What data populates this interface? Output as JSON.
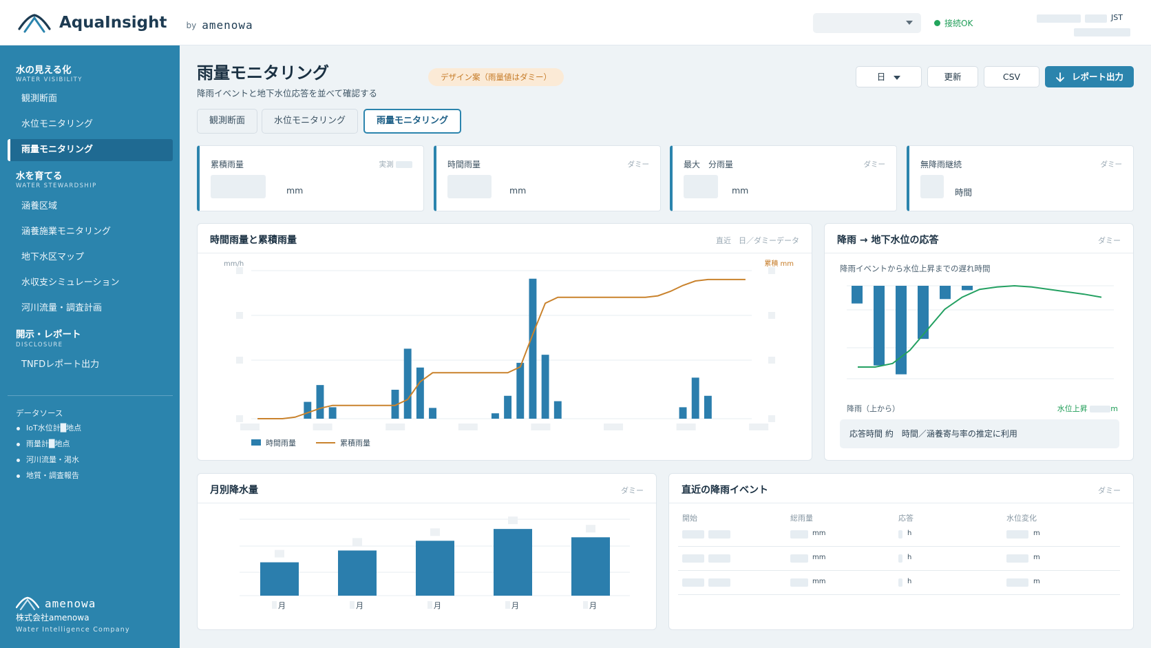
{
  "header": {
    "app_name": "AquaInsight",
    "by": "by",
    "vendor": "amenowa",
    "status": "接続OK",
    "timezone": "JST"
  },
  "sidebar": {
    "sections": [
      {
        "title": "水の見える化",
        "sub": "WATER VISIBILITY"
      },
      {
        "title": "水を育てる",
        "sub": "WATER STEWARDSHIP"
      },
      {
        "title": "開示・レポート",
        "sub": "DISCLOSURE"
      }
    ],
    "items": [
      {
        "label": "観測断面"
      },
      {
        "label": "水位モニタリング"
      },
      {
        "label": "雨量モニタリング"
      },
      {
        "label": "涵養区域"
      },
      {
        "label": "涵養施業モニタリング"
      },
      {
        "label": "地下水区マップ"
      },
      {
        "label": "水収支シミュレーション"
      },
      {
        "label": "河川流量・調査計画"
      },
      {
        "label": "TNFDレポート出力"
      }
    ],
    "datasource_title": "データソース",
    "datasources": [
      "IoT水位計█地点",
      "雨量計█地点",
      "河川流量・渇水",
      "地質・調査報告"
    ],
    "footer": {
      "brand": "amenowa",
      "company": "株式会社amenowa",
      "tagline": "Water Intelligence Company"
    }
  },
  "page": {
    "title": "雨量モニタリング",
    "subtitle": "降雨イベントと地下水位応答を並べて確認する",
    "design_badge": "デザイン案（雨量値はダミー）"
  },
  "toolbar": {
    "period": "日",
    "refresh": "更新",
    "csv": "CSV",
    "report": "レポート出力"
  },
  "tabs": [
    "観測断面",
    "水位モニタリング",
    "雨量モニタリング"
  ],
  "kpis": [
    {
      "label": "累積雨量",
      "tag": "実測",
      "unit": "mm"
    },
    {
      "label": "時間雨量",
      "tag": "ダミー",
      "unit": "mm"
    },
    {
      "label": "最大　分雨量",
      "tag": "ダミー",
      "unit": "mm"
    },
    {
      "label": "無降雨継続",
      "tag": "ダミー",
      "unit": "時間"
    }
  ],
  "panels": {
    "hourly": {
      "title": "時間雨量と累積雨量",
      "tag": "直近　日／ダミーデータ"
    },
    "response": {
      "title": "降雨 → 地下水位の応答",
      "tag": "ダミー",
      "subtitle": "降雨イベントから水位上昇までの遅れ時間",
      "left_label": "降雨（上から）",
      "right_label": "水位上昇",
      "right_unit": "m",
      "note": "応答時間 約　時間／涵養寄与率の推定に利用"
    },
    "monthly": {
      "title": "月別降水量",
      "tag": "ダミー",
      "month_unit": "月"
    },
    "events": {
      "title": "直近の降雨イベント",
      "tag": "ダミー",
      "headers": [
        "開始",
        "総雨量",
        "応答",
        "水位変化"
      ],
      "units": [
        "mm",
        "h",
        "m"
      ],
      "row_count": 3
    }
  },
  "chart_data": [
    {
      "type": "bar",
      "title": "時間雨量と累積雨量",
      "y_left_label": "mm/h",
      "y_right_label": "累積 mm",
      "series": [
        {
          "name": "時間雨量",
          "type": "bar",
          "values": [
            0,
            0,
            0,
            0,
            2.5,
            5,
            1.7,
            0,
            0,
            0,
            0,
            4.3,
            10.4,
            7.6,
            1.6,
            0,
            0,
            0,
            0,
            0.8,
            3.4,
            8.3,
            20.8,
            9.5,
            2.6,
            0,
            0,
            0,
            0,
            0,
            0,
            0,
            0,
            0,
            1.7,
            6.1,
            3.4,
            0,
            0,
            0
          ]
        },
        {
          "name": "累積雨量",
          "type": "line",
          "values": [
            0,
            0,
            0,
            1,
            4,
            7,
            9,
            9,
            9,
            9,
            9,
            9,
            13,
            25,
            31,
            31,
            31,
            31,
            31,
            31,
            31,
            35,
            57,
            78,
            82,
            82,
            82,
            82,
            82,
            82,
            82,
            82,
            83,
            86,
            90,
            93,
            94,
            94,
            94,
            94
          ]
        }
      ],
      "legend": "bottom-left",
      "grid": true
    },
    {
      "type": "bar",
      "title": "降雨 → 地下水位の応答",
      "series": [
        {
          "name": "降雨（上から）",
          "type": "bar",
          "values": [
            2,
            9,
            10,
            6,
            1.5,
            0.5
          ]
        },
        {
          "name": "水位上昇",
          "type": "line",
          "values": [
            0,
            0,
            0.6,
            2.8,
            6.2,
            9.6,
            11.6,
            12.9,
            13.3,
            13.5,
            13.3,
            12.9,
            12.5,
            12.1,
            11.6
          ]
        }
      ],
      "grid": true
    },
    {
      "type": "bar",
      "title": "月別降水量",
      "values": [
        48,
        65,
        79,
        96,
        84
      ],
      "ylim": [
        0,
        110
      ],
      "grid": true
    }
  ]
}
